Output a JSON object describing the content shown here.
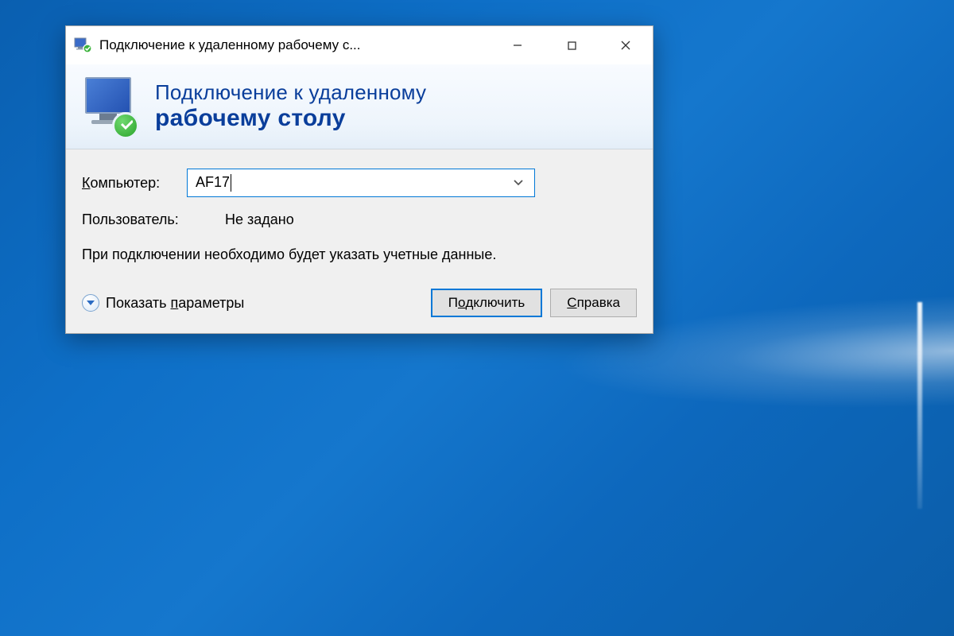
{
  "window": {
    "title": "Подключение к удаленному рабочему с..."
  },
  "banner": {
    "line1": "Подключение к удаленному",
    "line2": "рабочему столу"
  },
  "fields": {
    "computer_label_pre": "К",
    "computer_label_rest": "омпьютер:",
    "computer_value": "AF17",
    "user_label": "Пользователь:",
    "user_value": "Не задано"
  },
  "info": "При подключении необходимо будет указать учетные данные.",
  "footer": {
    "expand_label": "Показать ",
    "expand_label_u": "п",
    "expand_label_rest": "араметры",
    "connect_pre": "П",
    "connect_u": "о",
    "connect_rest": "дключить",
    "help_u": "С",
    "help_rest": "правка"
  }
}
